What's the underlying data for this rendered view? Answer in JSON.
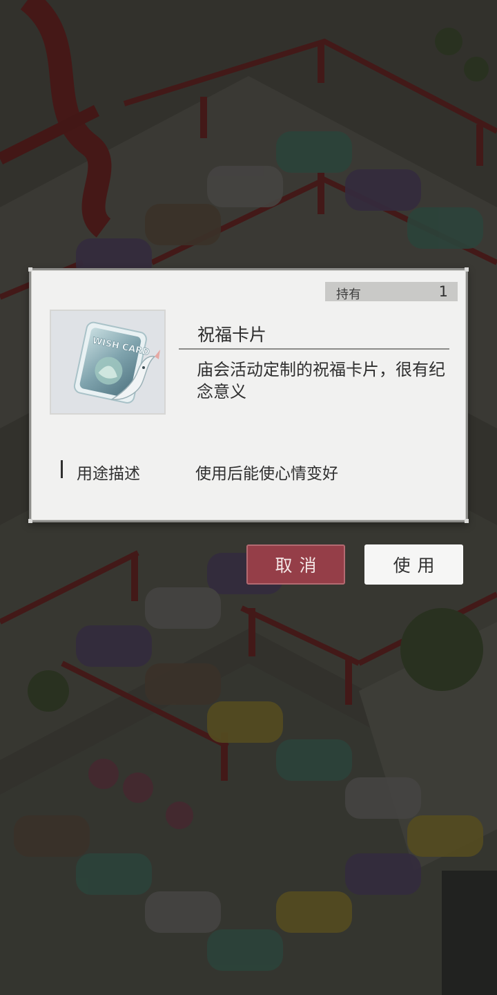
{
  "dialog": {
    "hold_label": "持有",
    "hold_count": "1",
    "item_name": "祝福卡片",
    "item_description": "庙会活动定制的祝福卡片，很有纪念意义",
    "usage_label": "用途描述",
    "usage_value": "使用后能使心情变好",
    "item_icon": "wish-card-icon",
    "item_icon_text": "WISH CARD"
  },
  "buttons": {
    "cancel": "取消",
    "use": "使用"
  },
  "colors": {
    "cancel_button": "#953e48",
    "use_button": "#f6f6f5",
    "dialog_bg": "#f1f1f0"
  }
}
